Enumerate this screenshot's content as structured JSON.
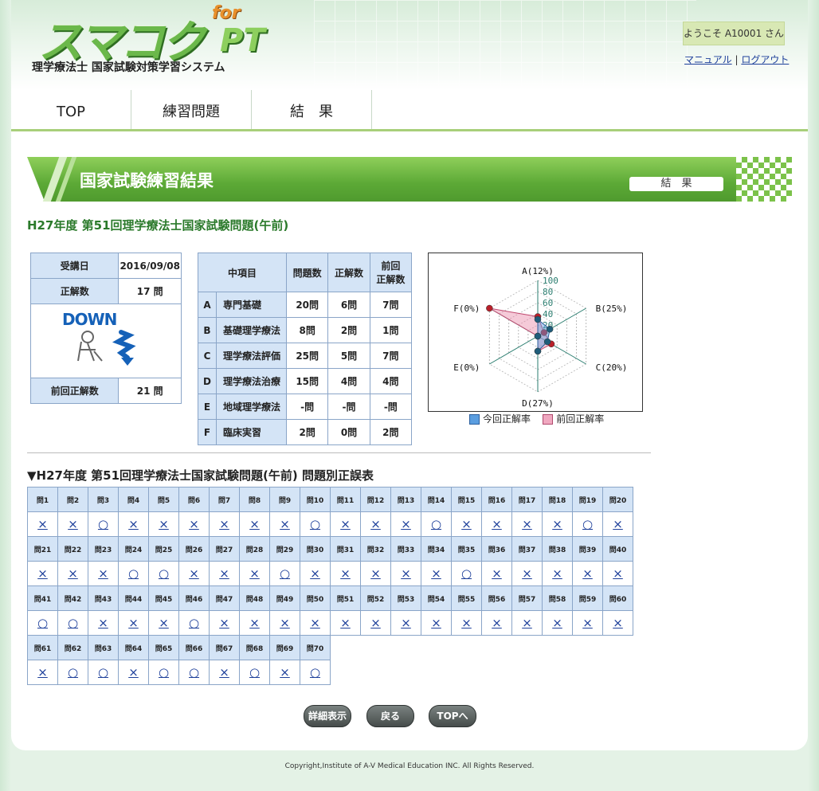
{
  "logo": {
    "main": "スマコク",
    "for": "for",
    "pt": "PT",
    "subtitle": "理学療法士 国家試験対策学習システム"
  },
  "header": {
    "welcome": "ようこそ A10001 さん",
    "manual": "マニュアル",
    "separator": "|",
    "logout": "ログアウト"
  },
  "nav": {
    "top": "TOP",
    "practice": "練習問題",
    "result": "結　果"
  },
  "banner": {
    "title": "国家試験練習結果",
    "badge": "結　果"
  },
  "exam_title": "H27年度 第51回理学療法士国家試験問題(午前)",
  "summary": {
    "date_label": "受講日",
    "date_value": "2016/09/08",
    "correct_label": "正解数",
    "correct_value": "17 問",
    "trend": "DOWN",
    "prev_label": "前回正解数",
    "prev_value": "21 問"
  },
  "category_table": {
    "headers": [
      "中項目",
      "問題数",
      "正解数",
      "前回\n正解数"
    ],
    "rows": [
      {
        "key": "A",
        "name": "専門基礎",
        "count": "20問",
        "correct": "6問",
        "prev": "7問"
      },
      {
        "key": "B",
        "name": "基礎理学療法",
        "count": "8問",
        "correct": "2問",
        "prev": "1問"
      },
      {
        "key": "C",
        "name": "理学療法評価",
        "count": "25問",
        "correct": "5問",
        "prev": "7問"
      },
      {
        "key": "D",
        "name": "理学療法治療",
        "count": "15問",
        "correct": "4問",
        "prev": "4問"
      },
      {
        "key": "E",
        "name": "地域理学療法",
        "count": "-問",
        "correct": "-問",
        "prev": "-問"
      },
      {
        "key": "F",
        "name": "臨床実習",
        "count": "2問",
        "correct": "0問",
        "prev": "2問"
      }
    ]
  },
  "chart_data": {
    "type": "radar",
    "axes": [
      "A(12%)",
      "B(25%)",
      "C(20%)",
      "D(27%)",
      "E(0%)",
      "F(0%)"
    ],
    "ticks": [
      "100",
      "80",
      "60",
      "40",
      "20"
    ],
    "range": [
      0,
      100
    ],
    "series": [
      {
        "name": "今回正解率",
        "values": [
          30,
          25,
          20,
          27,
          0,
          0
        ],
        "color": "#5b9ee0"
      },
      {
        "name": "前回正解率",
        "values": [
          35,
          13,
          28,
          27,
          0,
          100
        ],
        "color": "#e88aa8"
      }
    ],
    "legend": "bottom"
  },
  "answers_title": "▼H27年度 第51回理学療法士国家試験問題(午前) 問題別正誤表",
  "answers": [
    [
      "×",
      "×",
      "○",
      "×",
      "×",
      "×",
      "×",
      "×",
      "×",
      "○",
      "×",
      "×",
      "×",
      "○",
      "×",
      "×",
      "×",
      "×",
      "○",
      "×"
    ],
    [
      "×",
      "×",
      "×",
      "○",
      "○",
      "×",
      "×",
      "×",
      "○",
      "×",
      "×",
      "×",
      "×",
      "×",
      "○",
      "×",
      "×",
      "×",
      "×",
      "×"
    ],
    [
      "○",
      "○",
      "×",
      "×",
      "×",
      "○",
      "×",
      "×",
      "×",
      "×",
      "×",
      "×",
      "×",
      "×",
      "×",
      "×",
      "×",
      "×",
      "×",
      "×"
    ],
    [
      "×",
      "○",
      "○",
      "×",
      "○",
      "○",
      "×",
      "○",
      "×",
      "○"
    ]
  ],
  "question_prefix": "問",
  "buttons": {
    "detail": "詳細表示",
    "back": "戻る",
    "top": "TOPへ"
  },
  "footer": "Copyright,Institute of A-V Medical Education INC. All Rights Reserved.",
  "colors": {
    "accent": "#5ca936",
    "header_cell": "#d4e4f6",
    "link": "#1d3f9a"
  }
}
